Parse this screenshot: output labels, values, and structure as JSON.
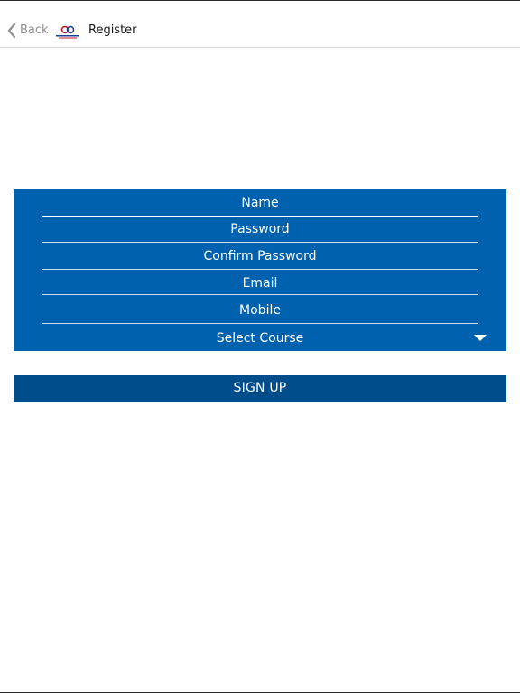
{
  "navbar": {
    "back_label": "Back",
    "title": "Register",
    "back_icon": "chevron-left-icon",
    "logo_icon": "academy-logo-icon"
  },
  "form": {
    "fields": [
      {
        "label": "Name"
      },
      {
        "label": "Password"
      },
      {
        "label": "Confirm Password"
      },
      {
        "label": "Email"
      },
      {
        "label": "Mobile"
      }
    ],
    "course_select": {
      "label": "Select Course",
      "icon": "triangle-down-icon"
    }
  },
  "actions": {
    "signup_label": "SIGN UP"
  },
  "colors": {
    "panel": "#0061ae",
    "button": "#004d8b",
    "text_on_blue": "#ffffff",
    "nav_text": "#1a1a1a",
    "back_text": "#8e8e8e"
  }
}
